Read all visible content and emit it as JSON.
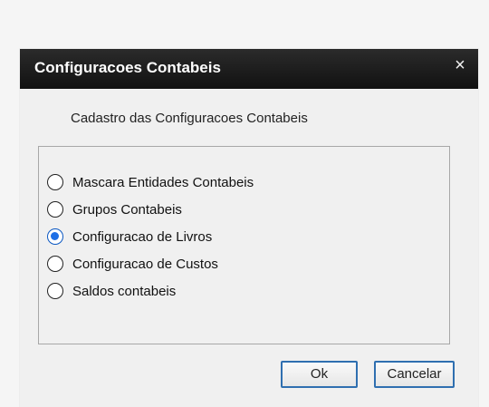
{
  "dialog": {
    "title": "Configuracoes Contabeis",
    "close_icon": "close-icon",
    "subtitle": "Cadastro das Configuracoes Contabeis",
    "options": [
      {
        "label": "Mascara Entidades Contabeis",
        "checked": false
      },
      {
        "label": "Grupos Contabeis",
        "checked": false
      },
      {
        "label": "Configuracao de Livros",
        "checked": true
      },
      {
        "label": "Configuracao de Custos",
        "checked": false
      },
      {
        "label": "Saldos contabeis",
        "checked": false
      }
    ],
    "buttons": {
      "ok": "Ok",
      "cancel": "Cancelar"
    }
  },
  "colors": {
    "titlebar": "#111111",
    "accent": "#1e6fe6",
    "button_border": "#2f6fb0"
  }
}
